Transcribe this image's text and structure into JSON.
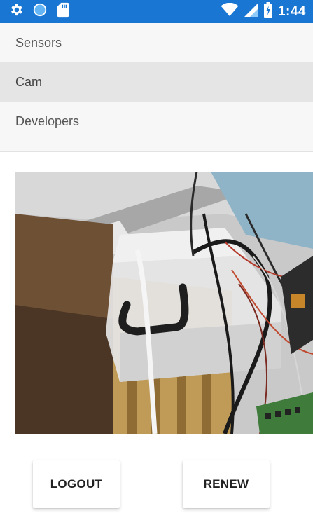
{
  "status_bar": {
    "background": "#1976d2",
    "icons_left": [
      "settings-gear-icon",
      "circle-icon",
      "sd-card-icon"
    ],
    "icons_right": [
      "wifi-icon",
      "signal-icon",
      "battery-icon"
    ],
    "time": "1:44"
  },
  "menu": {
    "items": [
      {
        "label": "Sensors",
        "active": false
      },
      {
        "label": "Cam",
        "active": true
      },
      {
        "label": "Developers",
        "active": false
      }
    ]
  },
  "camera": {
    "content": "live camera image"
  },
  "buttons": {
    "logout_label": "LOGOUT",
    "renew_label": "RENEW"
  }
}
